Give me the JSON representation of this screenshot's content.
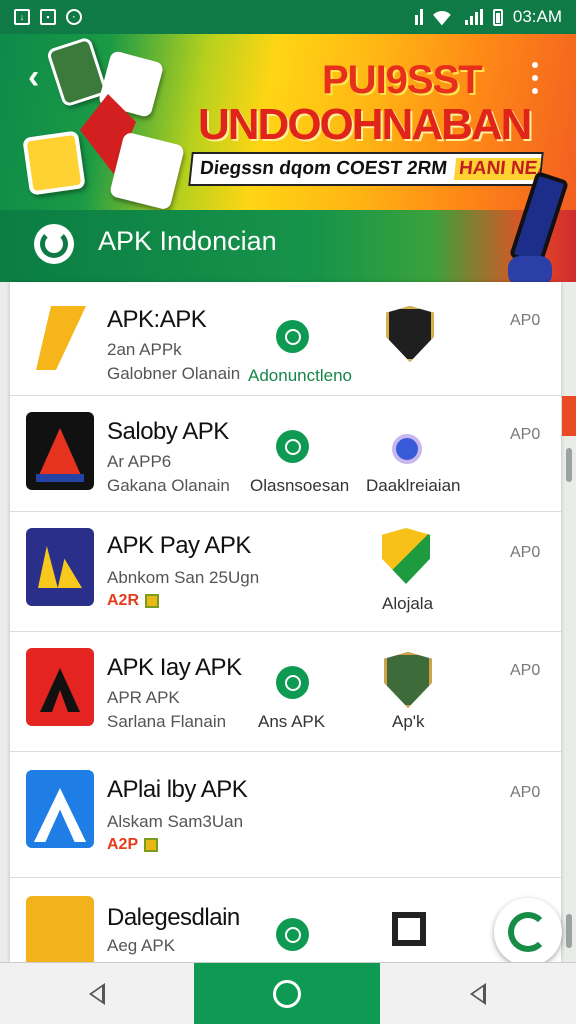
{
  "status_bar": {
    "time": "03:AM"
  },
  "banner": {
    "title_line1": "PUI9SST",
    "title_line2": "UNDOOHNABAN",
    "strip_text": "Diegssn dqom COEST 2RM",
    "strip_highlight": "HANI NEANTA",
    "app_name": "APK Indoncian"
  },
  "apps": [
    {
      "title": "APK:APK",
      "line1": "2an APPk",
      "line2": "Galobner Olanain",
      "mid_label": "Adonunctleno",
      "right_label": "",
      "code": "AP0"
    },
    {
      "title": "Saloby APK",
      "line1": "Ar APP6",
      "line2": "Gakana Olanain",
      "mid_label": "Olasnsoesan",
      "right_label": "Daaklreiaian",
      "code": "AP0"
    },
    {
      "title": "APK Pay APK",
      "line1": "Abnkom San 25Ugn",
      "badge": "A2R",
      "mid_label": "",
      "right_label": "Alojala",
      "code": "AP0"
    },
    {
      "title": "APK Iay APK",
      "line1": "APR APK",
      "line2": "Sarlana Flanain",
      "mid_label": "Ans APK",
      "right_label": "Ap'k",
      "code": "AP0"
    },
    {
      "title": "APlai lby APK",
      "line1": "Alskam Sam3Uan",
      "badge": "A2P",
      "mid_label": "",
      "right_label": "",
      "code": "AP0"
    },
    {
      "title": "Dalegesdlain",
      "line1": "Aeg APK",
      "mid_label": "",
      "right_label": "",
      "code": ""
    }
  ],
  "colors": {
    "brand_green": "#0f9a53",
    "accent_red": "#e82f1c",
    "accent_yellow": "#ffd514"
  }
}
